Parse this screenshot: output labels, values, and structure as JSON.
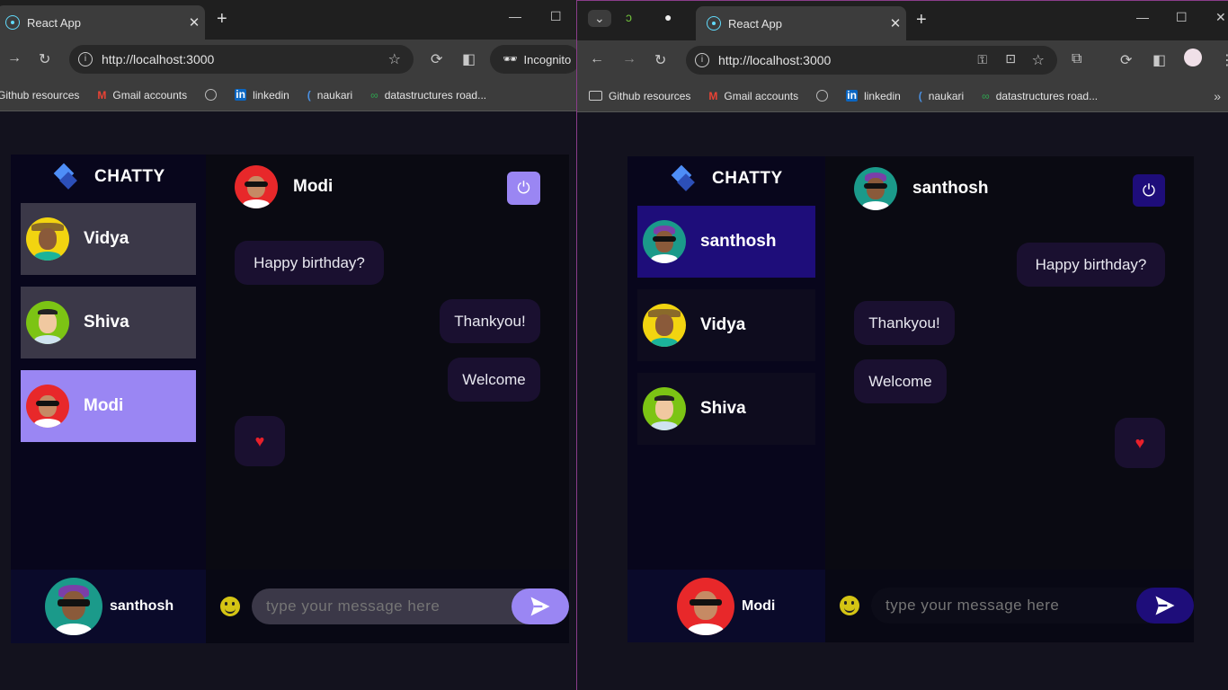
{
  "left_window": {
    "tab_title": "React App",
    "url": "http://localhost:3000",
    "incognito_label": "Incognito",
    "bookmarks": [
      "Github resources",
      "Gmail accounts",
      "linkedin",
      "naukari",
      "datastructures road..."
    ],
    "app": {
      "brand": "CHATTY",
      "contacts": [
        "Vidya",
        "Shiva",
        "Modi"
      ],
      "selected_contact": "Modi",
      "header_name": "Modi",
      "messages": [
        {
          "text": "Happy birthday?",
          "side": "left"
        },
        {
          "text": "Thankyou!",
          "side": "right"
        },
        {
          "text": "Welcome",
          "side": "right"
        },
        {
          "text": "♥",
          "side": "left"
        }
      ],
      "current_user": "santhosh",
      "input_placeholder": "type your message here"
    }
  },
  "right_window": {
    "tab_title": "React App",
    "url": "http://localhost:3000",
    "bookmarks": [
      "Github resources",
      "Gmail accounts",
      "linkedin",
      "naukari",
      "datastructures road..."
    ],
    "app": {
      "brand": "CHATTY",
      "contacts": [
        "santhosh",
        "Vidya",
        "Shiva"
      ],
      "selected_contact": "santhosh",
      "header_name": "santhosh",
      "messages": [
        {
          "text": "Happy birthday?",
          "side": "right"
        },
        {
          "text": "Thankyou!",
          "side": "left"
        },
        {
          "text": "Welcome",
          "side": "left"
        },
        {
          "text": "♥",
          "side": "right"
        }
      ],
      "current_user": "Modi",
      "input_placeholder": "type your message here"
    }
  },
  "colors": {
    "left_accent": "#9a86f3",
    "right_accent": "#1e0d7a",
    "contact_card": "#3b3848",
    "bubble": "#1a1030"
  },
  "icons": [
    "back-icon",
    "forward-icon",
    "reload-icon",
    "info-icon",
    "star-icon",
    "power-icon",
    "emoji-icon",
    "send-icon",
    "heart-icon"
  ]
}
